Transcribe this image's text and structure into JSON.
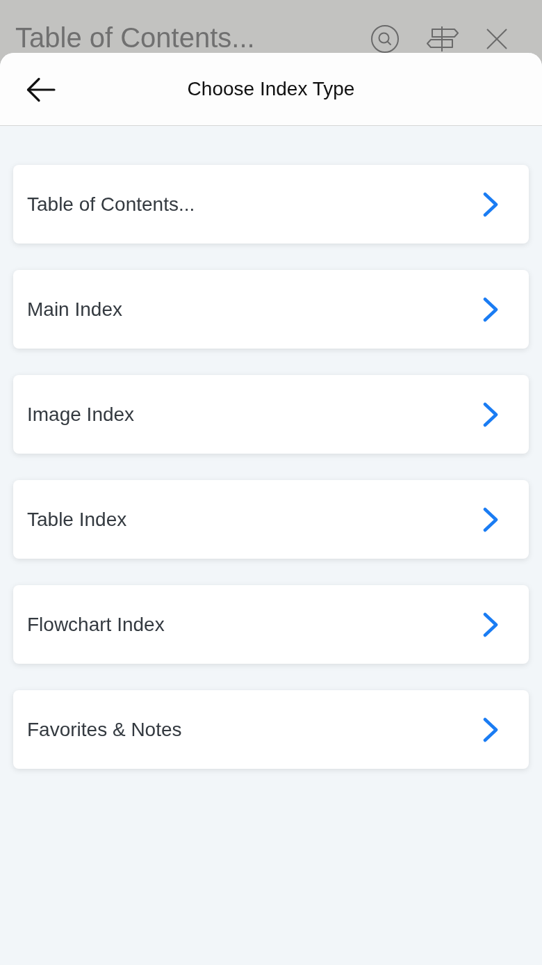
{
  "backdrop": {
    "title": "Table of Contents..."
  },
  "sheet": {
    "title": "Choose Index Type"
  },
  "items": [
    {
      "label": "Table of Contents..."
    },
    {
      "label": "Main Index"
    },
    {
      "label": "Image Index"
    },
    {
      "label": "Table Index"
    },
    {
      "label": "Flowchart Index"
    },
    {
      "label": "Favorites & Notes"
    }
  ]
}
